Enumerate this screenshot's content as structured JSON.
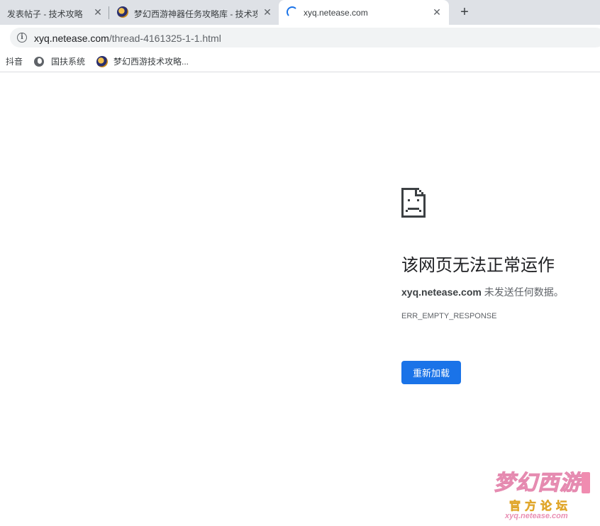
{
  "tabs": [
    {
      "title": "发表帖子 - 技术攻略",
      "close_glyph": "✕",
      "active": false
    },
    {
      "title": "梦幻西游神器任务攻略库 - 技术攻",
      "close_glyph": "✕",
      "active": false,
      "icon": "mhxy-favicon"
    },
    {
      "title": "xyq.netease.com",
      "close_glyph": "✕",
      "active": true,
      "icon": "loading-spinner"
    }
  ],
  "new_tab_glyph": "+",
  "omnibox": {
    "info_glyph": "i",
    "url_host": "xyq.netease.com",
    "url_path": "/thread-4161325-1-1.html"
  },
  "bookmarks": [
    {
      "label": "抖音"
    },
    {
      "label": "国扶系统",
      "icon": "globe-icon"
    },
    {
      "label": "梦幻西游技术攻略...",
      "icon": "mhxy-favicon"
    }
  ],
  "error": {
    "icon": "sad-document-icon",
    "title": "该网页无法正常运作",
    "host": "xyq.netease.com",
    "message": " 未发送任何数据。",
    "code": "ERR_EMPTY_RESPONSE",
    "reload_label": "重新加载"
  },
  "watermark": {
    "title": "梦幻西游",
    "subtitle": "官方论坛",
    "url": "xyq.netease.com"
  },
  "colors": {
    "tabstrip": "#dee1e6",
    "accent": "#1a73e8",
    "text": "#202124",
    "muted": "#5f6368"
  }
}
